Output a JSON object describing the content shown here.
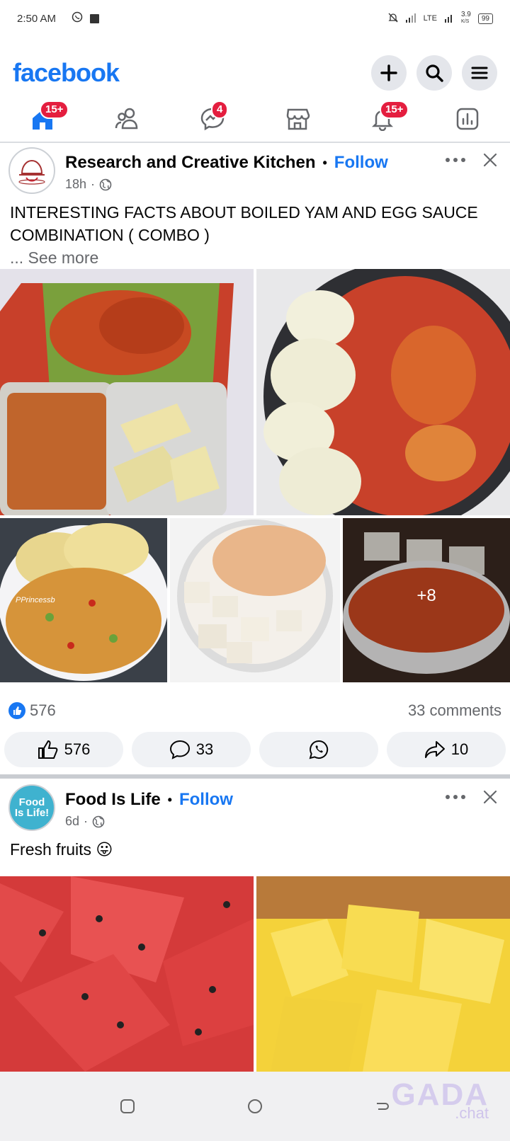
{
  "status_bar": {
    "time": "2:50 AM",
    "network": "LTE",
    "speed": "3.9",
    "speed_unit": "K/S",
    "battery": "99"
  },
  "header": {
    "logo": "facebook",
    "icons": [
      "plus-icon",
      "search-icon",
      "menu-icon"
    ]
  },
  "nav_tabs": [
    {
      "name": "home",
      "badge": "15+"
    },
    {
      "name": "friends",
      "badge": ""
    },
    {
      "name": "messenger",
      "badge": "4"
    },
    {
      "name": "marketplace",
      "badge": ""
    },
    {
      "name": "notifications",
      "badge": "15+"
    },
    {
      "name": "dashboard",
      "badge": ""
    }
  ],
  "posts": [
    {
      "author": "Research and Creative Kitchen",
      "follow": "Follow",
      "time": "18h",
      "text": "INTERESTING FACTS ABOUT BOILED YAM AND EGG SAUCE COMBINATION ( COMBO )",
      "see_more": "... See more",
      "watermark_text": "PPrincessb",
      "more_photos": "+8",
      "reactions_count": "576",
      "comments_count": "33 comments",
      "like_label": "576",
      "comment_label": "33",
      "share_label": "10"
    },
    {
      "author": "Food Is Life",
      "follow": "Follow",
      "time": "6d",
      "text": "Fresh fruits 😛",
      "avatar_text": "Food Is Life!"
    }
  ],
  "watermark": {
    "brand": "GADA",
    "sub": ".chat"
  },
  "colors": {
    "brand_blue": "#1877f2",
    "badge_red": "#e41e3f",
    "pill_bg": "#f0f2f5"
  }
}
